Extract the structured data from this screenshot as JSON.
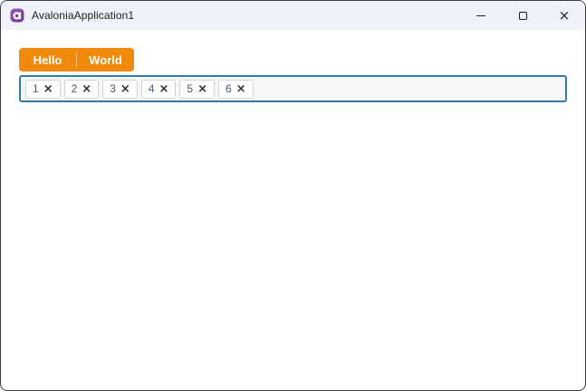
{
  "window": {
    "title": "AvaloniaApplication1",
    "border_color": "#3B3B3B",
    "titlebar_bg": "#EFF3F9"
  },
  "titlebar": {
    "icons": {
      "app_icon": "avalonia-logo-icon",
      "minimize": "minimize-icon",
      "maximize": "maximize-icon",
      "close": "close-icon"
    },
    "close_glyph": "×"
  },
  "split_button": {
    "accent_color": "#F18A0B",
    "buttons": [
      {
        "label": "Hello"
      },
      {
        "label": "World"
      }
    ]
  },
  "tag_input": {
    "border_color": "#2E7DA6",
    "background": "#F7F7F7",
    "chips": [
      {
        "label": "1",
        "close_glyph": "×"
      },
      {
        "label": "2",
        "close_glyph": "×"
      },
      {
        "label": "3",
        "close_glyph": "×"
      },
      {
        "label": "4",
        "close_glyph": "×"
      },
      {
        "label": "5",
        "close_glyph": "×"
      },
      {
        "label": "6",
        "close_glyph": "×"
      }
    ]
  }
}
